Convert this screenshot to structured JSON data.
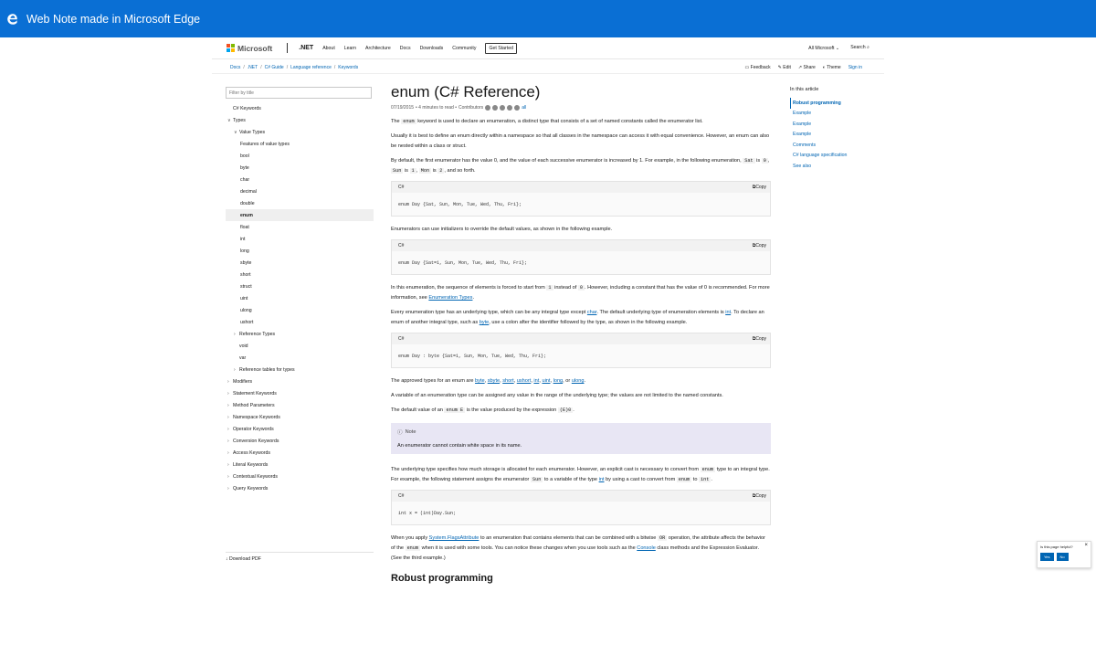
{
  "titlebar": {
    "title": "Web Note made in Microsoft Edge"
  },
  "topnav": {
    "brand": "Microsoft",
    "product": ".NET",
    "links": [
      "About",
      "Learn",
      "Architecture",
      "Docs",
      "Downloads",
      "Community"
    ],
    "get_started": "Get Started",
    "all_microsoft": "All Microsoft",
    "search": "Search"
  },
  "breadcrumbs": [
    "Docs",
    ".NET",
    "C# Guide",
    "Language reference",
    "Keywords"
  ],
  "actions": {
    "feedback": "Feedback",
    "edit": "Edit",
    "share": "Share",
    "theme": "Theme",
    "signin": "Sign in"
  },
  "sidebar": {
    "filter_placeholder": "Filter by title",
    "items": [
      {
        "label": "C# Keywords",
        "chev": "",
        "indent": 0
      },
      {
        "label": "Types",
        "chev": "∨",
        "indent": 0
      },
      {
        "label": "Value Types",
        "chev": "∨",
        "indent": 1
      },
      {
        "label": "Features of value types",
        "chev": "",
        "indent": 2
      },
      {
        "label": "bool",
        "chev": "",
        "indent": 2
      },
      {
        "label": "byte",
        "chev": "",
        "indent": 2
      },
      {
        "label": "char",
        "chev": "",
        "indent": 2
      },
      {
        "label": "decimal",
        "chev": "",
        "indent": 2
      },
      {
        "label": "double",
        "chev": "",
        "indent": 2
      },
      {
        "label": "enum",
        "chev": "",
        "indent": 2,
        "selected": true
      },
      {
        "label": "float",
        "chev": "",
        "indent": 2
      },
      {
        "label": "int",
        "chev": "",
        "indent": 2
      },
      {
        "label": "long",
        "chev": "",
        "indent": 2
      },
      {
        "label": "sbyte",
        "chev": "",
        "indent": 2
      },
      {
        "label": "short",
        "chev": "",
        "indent": 2
      },
      {
        "label": "struct",
        "chev": "",
        "indent": 2
      },
      {
        "label": "uint",
        "chev": "",
        "indent": 2
      },
      {
        "label": "ulong",
        "chev": "",
        "indent": 2
      },
      {
        "label": "ushort",
        "chev": "",
        "indent": 2
      },
      {
        "label": "Reference Types",
        "chev": "›",
        "indent": 1
      },
      {
        "label": "void",
        "chev": "",
        "indent": 1
      },
      {
        "label": "var",
        "chev": "",
        "indent": 1
      },
      {
        "label": "Reference tables for types",
        "chev": "›",
        "indent": 1
      },
      {
        "label": "Modifiers",
        "chev": "›",
        "indent": 0
      },
      {
        "label": "Statement Keywords",
        "chev": "›",
        "indent": 0
      },
      {
        "label": "Method Parameters",
        "chev": "›",
        "indent": 0
      },
      {
        "label": "Namespace Keywords",
        "chev": "›",
        "indent": 0
      },
      {
        "label": "Operator Keywords",
        "chev": "›",
        "indent": 0
      },
      {
        "label": "Conversion Keywords",
        "chev": "›",
        "indent": 0
      },
      {
        "label": "Access Keywords",
        "chev": "›",
        "indent": 0
      },
      {
        "label": "Literal Keywords",
        "chev": "›",
        "indent": 0
      },
      {
        "label": "Contextual Keywords",
        "chev": "›",
        "indent": 0
      },
      {
        "label": "Query Keywords",
        "chev": "›",
        "indent": 0
      }
    ],
    "download_pdf": "Download PDF"
  },
  "article": {
    "title": "enum (C# Reference)",
    "date": "07/19/2015",
    "read_time": "• 4 minutes to read •",
    "contributors": "Contributors",
    "all": "all",
    "p1a": "The ",
    "p1code": "enum",
    "p1b": " keyword is used to declare an enumeration, a distinct type that consists of a set of named constants called the enumerator list.",
    "p2": "Usually it is best to define an enum directly within a namespace so that all classes in the namespace can access it with equal convenience. However, an enum can also be nested within a class or struct.",
    "p3a": "By default, the first enumerator has the value 0, and the value of each successive enumerator is increased by 1. For example, in the following enumeration, ",
    "p3c1": "Sat",
    "p3b": " is ",
    "p3c2": "0",
    "p3d": ", ",
    "p3c3": "Sun",
    "p3e": " is ",
    "p3c4": "1",
    "p3f": ", ",
    "p3c5": "Mon",
    "p3g": " is ",
    "p3c6": "2",
    "p3h": ", and so forth.",
    "code1_lang": "C#",
    "code1": "enum Day {Sat, Sun, Mon, Tue, Wed, Thu, Fri};",
    "p4": "Enumerators can use initializers to override the default values, as shown in the following example.",
    "code2_lang": "C#",
    "code2": "enum Day {Sat=1, Sun, Mon, Tue, Wed, Thu, Fri};",
    "p5a": "In this enumeration, the sequence of elements is forced to start from ",
    "p5c1": "1",
    "p5b": " instead of ",
    "p5c2": "0",
    "p5c": ". However, including a constant that has the value of 0 is recommended. For more information, see ",
    "p5link": "Enumeration Types",
    "p5d": ".",
    "p6a": "Every enumeration type has an underlying type, which can be any integral type except ",
    "p6l1": "char",
    "p6b": ". The default underlying type of enumeration elements is ",
    "p6l2": "int",
    "p6c": ". To declare an enum of another integral type, such as ",
    "p6l3": "byte",
    "p6d": ", use a colon after the identifier followed by the type, as shown in the following example.",
    "code3_lang": "C#",
    "code3": "enum Day : byte {Sat=1, Sun, Mon, Tue, Wed, Thu, Fri};",
    "p7a": "The approved types for an enum are ",
    "p7links": [
      "byte",
      "sbyte",
      "short",
      "ushort",
      "int",
      "uint",
      "long"
    ],
    "p7or": ", or ",
    "p7last": "ulong",
    "p7end": ".",
    "p8": "A variable of an enumeration type can be assigned any value in the range of the underlying type; the values are not limited to the named constants.",
    "p9a": "The default value of an ",
    "p9c1": "enum E",
    "p9b": " is the value produced by the expression ",
    "p9c2": "(E)0",
    "p9c": ".",
    "note_title": "Note",
    "note_body": "An enumerator cannot contain white space in its name.",
    "p10a": "The underlying type specifies how much storage is allocated for each enumerator. However, an explicit cast is necessary to convert from ",
    "p10c1": "enum",
    "p10b": " type to an integral type. For example, the following statement assigns the enumerator ",
    "p10c2": "Sun",
    "p10c": " to a variable of the type ",
    "p10l": "int",
    "p10d": " by using a cast to convert from ",
    "p10c3": "enum",
    "p10e": " to ",
    "p10c4": "int",
    "p10f": ".",
    "code4_lang": "C#",
    "code4": "int x = (int)Day.Sun;",
    "p11a": "When you apply ",
    "p11l1": "System.FlagsAttribute",
    "p11b": " to an enumeration that contains elements that can be combined with a bitwise ",
    "p11c1": "OR",
    "p11c": " operation, the attribute affects the behavior of the ",
    "p11c2": "enum",
    "p11d": " when it is used with some tools. You can notice these changes when you use tools such as the ",
    "p11l2": "Console",
    "p11e": " class methods and the Expression Evaluator. (See the third example.)",
    "h2": "Robust programming",
    "copy": "Copy"
  },
  "rightnav": {
    "header": "In this article",
    "items": [
      "Robust programming",
      "Example",
      "Example",
      "Example",
      "Comments",
      "C# language specification",
      "See also"
    ]
  },
  "feedback": {
    "question": "Is this page helpful?",
    "yes": "Yes",
    "no": "No"
  },
  "colors": {
    "titlebar": "#0a6fd4",
    "link": "#0065b3",
    "note_bg": "#e8e6f4"
  }
}
